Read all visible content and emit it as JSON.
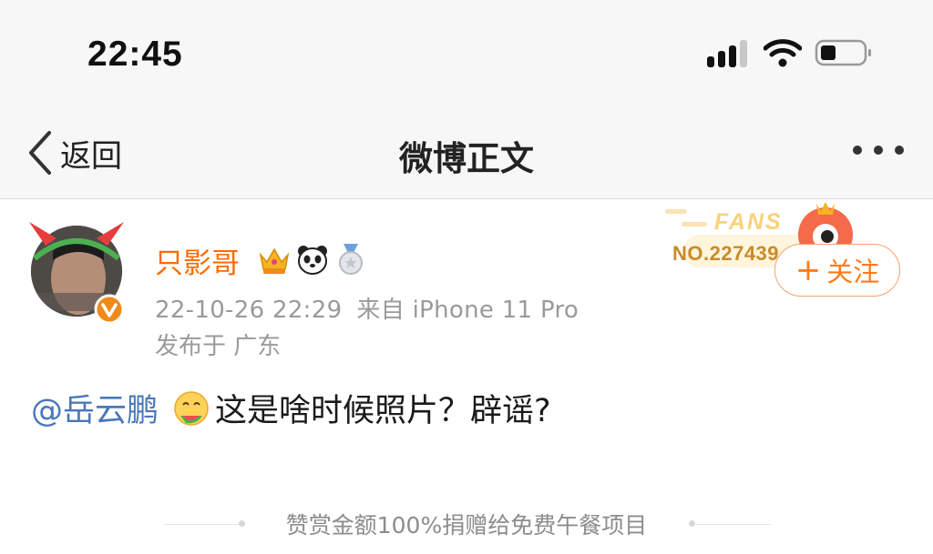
{
  "status_bar": {
    "time": "22:45"
  },
  "nav": {
    "back_label": "返回",
    "title": "微博正文"
  },
  "post": {
    "username": "只影哥",
    "timestamp": "22-10-26 22:29",
    "source": "来自 iPhone 11 Pro",
    "location": "发布于 广东",
    "mention": "@岳云鹏",
    "text": "这是啥时候照片？辟谣?",
    "badges": [
      "crown-badge-icon",
      "panda-icon",
      "medal-icon"
    ]
  },
  "fans_card": {
    "label": "FANS",
    "number": "NO.2274392"
  },
  "follow": {
    "plus": "+",
    "label": "关注"
  },
  "footer": {
    "reward_text": "赞赏金额100%捐赠给免费午餐项目"
  },
  "colors": {
    "username": "#ff6a00",
    "mention": "#4a78b8",
    "follow": "#ff7a1a",
    "verified": "#f08a1a"
  }
}
